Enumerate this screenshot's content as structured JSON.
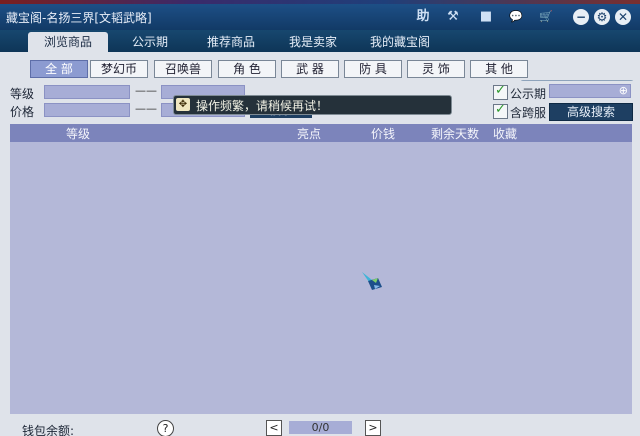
{
  "window": {
    "title": "藏宝阁-名扬三界[文韬武略]"
  },
  "titlebar": {
    "icons": [
      {
        "name": "help-icon",
        "glyph": "助"
      },
      {
        "name": "hammer-icon",
        "glyph": "⚒"
      },
      {
        "name": "stop-icon",
        "glyph": "■"
      },
      {
        "name": "chat-icon",
        "glyph": "💬"
      },
      {
        "name": "cart-icon",
        "glyph": "🛒"
      }
    ],
    "minimize": "−",
    "settings": "⚙",
    "close": "✕"
  },
  "tabs": [
    {
      "label": "浏览商品",
      "active": true
    },
    {
      "label": "公示期",
      "active": false
    },
    {
      "label": "推荐商品",
      "active": false
    },
    {
      "label": "我是卖家",
      "active": false
    },
    {
      "label": "我的藏宝阁",
      "active": false
    }
  ],
  "search": {
    "icon": "search-icon"
  },
  "categories": [
    {
      "label": "全 部",
      "active": true
    },
    {
      "label": "梦幻币",
      "active": false
    },
    {
      "label": "召唤兽",
      "active": false
    },
    {
      "label": "角 色",
      "active": false
    },
    {
      "label": "武 器",
      "active": false
    },
    {
      "label": "防 具",
      "active": false
    },
    {
      "label": "灵 饰",
      "active": false
    },
    {
      "label": "其 他",
      "active": false
    }
  ],
  "filters": {
    "level_label": "等级",
    "price_label": "价格",
    "dash": "——",
    "search_button": "搜索",
    "publicity_label": "公示期",
    "cross_server_label": "含跨服",
    "advanced_search": "高级搜索"
  },
  "tooltip": {
    "text": "操作频繁，请稍候再试！"
  },
  "table": {
    "columns": [
      "等级",
      "亮点",
      "价钱",
      "剩余天数",
      "收藏"
    ]
  },
  "footer": {
    "wallet_label": "钱包余额:",
    "help": "?",
    "prev": "<",
    "next": ">",
    "page": "0/0"
  },
  "colors": {
    "titlebar": "#1d4f86",
    "table_header": "#7c84bb",
    "table_body": "#b4b8d8",
    "active_category": "#8c9bd1"
  }
}
